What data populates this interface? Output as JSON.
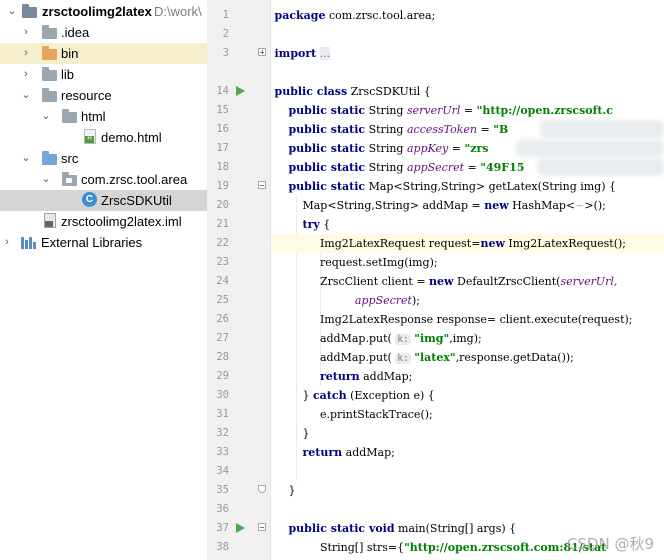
{
  "project_tree": {
    "root": {
      "name": "zrsctoolimg2latex",
      "path": "D:\\work\\"
    },
    "items": [
      {
        "label": ".idea"
      },
      {
        "label": "bin"
      },
      {
        "label": "lib"
      },
      {
        "label": "resource"
      },
      {
        "label": "html"
      },
      {
        "label": "demo.html"
      },
      {
        "label": "src"
      },
      {
        "label": "com.zrsc.tool.area"
      },
      {
        "label": "ZrscSDKUtil"
      },
      {
        "label": "zrsctoolimg2latex.iml"
      },
      {
        "label": "External Libraries"
      }
    ]
  },
  "editor": {
    "line_numbers": [
      "1",
      "2",
      "3",
      "14",
      "15",
      "16",
      "17",
      "18",
      "19",
      "20",
      "21",
      "22",
      "23",
      "24",
      "25",
      "26",
      "27",
      "28",
      "29",
      "30",
      "31",
      "32",
      "33",
      "34",
      "35",
      "36",
      "37",
      "38"
    ],
    "code": {
      "l1_kw": "package",
      "l1_rest": " com.zrsc.tool.area;",
      "l3_kw": "import",
      "l3_fold": "...",
      "l14_kw": "public class",
      "l14_rest": " ZrscSDKUtil {",
      "ps": "public static",
      "string_t": " String ",
      "f_serverUrl": "serverUrl",
      "v_serverUrl": "\"http://open.zrscsoft.c",
      "f_accessToken": "accessToken",
      "v_accessToken": "\"B",
      "f_appKey": "appKey",
      "v_appKey": "\"zrs",
      "f_appSecret": "appSecret",
      "v_appSecret": "\"49F15",
      "eq": " = ",
      "l19_rest": " Map<String,String> getLatex(String img) {",
      "l20_a": "Map<String,String> addMap = ",
      "kw_new": "new",
      "l20_b": " HashMap<",
      "l20_c": ">();",
      "l21_kw": "try",
      "l21_rest": " {",
      "l22_a": "Img2LatexRequest request=",
      "l22_b": " Img2LatexRequest();",
      "l23": "request.setImg(img);",
      "l24_a": "ZrscClient client = ",
      "l24_b": " DefaultZrscClient(",
      "l24_c": "serverUrl,",
      "l25_f": "appSecret",
      "l25_rest": ");",
      "l26": "Img2LatexResponse response= client.execute(request);",
      "l27_a": "addMap.put(",
      "hint_k": "k:",
      "l27_s": "\"img\"",
      "l27_b": ",img);",
      "l28_a": "addMap.put(",
      "l28_s": "\"latex\"",
      "l28_b": ",response.getData());",
      "kw_return": "return",
      "l29_rest": " addMap;",
      "l30_a": "} ",
      "kw_catch": "catch",
      "l30_b": " (Exception e) {",
      "l31": "e.printStackTrace();",
      "l32": "}",
      "l33_rest": " addMap;",
      "l35": "}",
      "l37_kw": "public static void",
      "l37_rest": " main(String[] args) {",
      "l38_a": "String[] strs={",
      "l38_s": "\"http://open.zrscsoft.com:81/stat"
    }
  },
  "watermark": "CSDN @秋9",
  "colors": {
    "keyword": "#000080",
    "string": "#008000",
    "field": "#660e7a",
    "selection": "#d5d5d5",
    "current_line": "#fffae3",
    "run_icon": "#4fa74f"
  }
}
